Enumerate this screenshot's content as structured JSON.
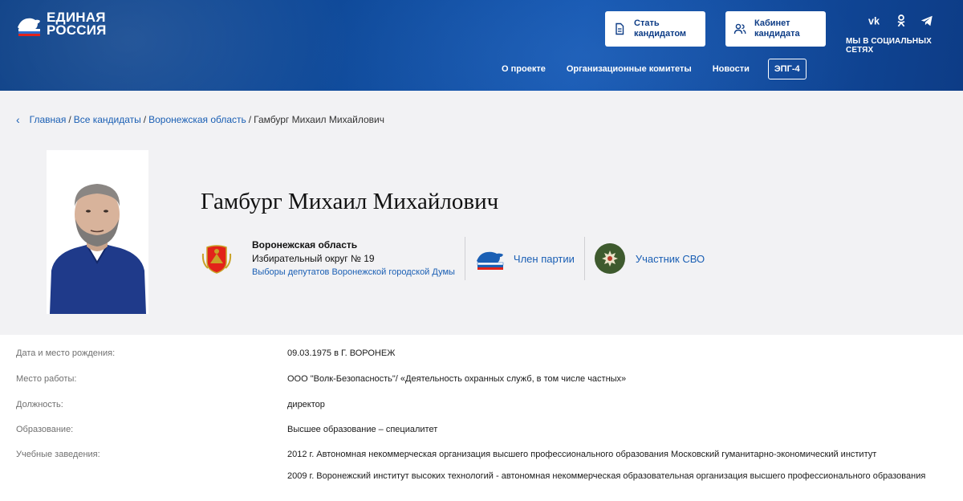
{
  "header": {
    "logo_line1": "ЕДИНАЯ",
    "logo_line2": "РОССИЯ",
    "btn_candidate_l1": "Стать",
    "btn_candidate_l2": "кандидатом",
    "btn_cabinet_l1": "Кабинет",
    "btn_cabinet_l2": "кандидата",
    "social_label": "МЫ В СОЦИАЛЬНЫХ СЕТЯХ",
    "social_icons": [
      "vk-icon",
      "odnoklassniki-icon",
      "telegram-icon"
    ],
    "nav": {
      "about": "О проекте",
      "committees": "Организационные комитеты",
      "news": "Новости",
      "epg": "ЭПГ-4"
    },
    "colors": {
      "header_bg": "#0f4a9a",
      "accent": "#1a5fb4",
      "brand_red": "#e2231a"
    }
  },
  "breadcrumb": {
    "home": "Главная",
    "sep1": "/",
    "all": "Все кандидаты",
    "sep2": "/",
    "region": "Воронежская область",
    "sep3": "/",
    "current": "Гамбург Михаил Михайлович"
  },
  "candidate": {
    "name": "Гамбург Михаил Михайлович",
    "region": "Воронежская область",
    "district": "Избирательный округ № 19",
    "election": "Выборы депутатов Воронежской городской Думы",
    "party_status": "Член партии",
    "svo_status": "Участник СВО"
  },
  "details": [
    {
      "label": "Дата и место рождения:",
      "value": "09.03.1975 в Г. ВОРОНЕЖ"
    },
    {
      "label": "Место работы:",
      "value": "ООО \"Волк-Безопасность\"/ «Деятельность охранных служб, в том числе частных»"
    },
    {
      "label": "Должность:",
      "value": "директор"
    },
    {
      "label": "Образование:",
      "value": "Высшее образование – специалитет"
    },
    {
      "label": "Учебные заведения:",
      "value": "2012 г. Автономная некоммерческая организация высшего профессионального образования Московский гуманитарно-экономический институт"
    },
    {
      "label": "",
      "value": "2009 г. Воронежский институт высоких технологий - автономная некоммерческая образовательная организация высшего профессионального образования"
    }
  ]
}
